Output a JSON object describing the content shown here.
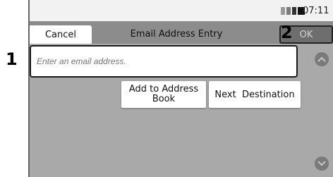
{
  "status_bar": {
    "time": "07:11",
    "signal_icon": "signal-bars-icon"
  },
  "header": {
    "cancel_label": "Cancel",
    "title": "Email Address Entry",
    "ok_label": "OK"
  },
  "email_input": {
    "value": "",
    "placeholder": "Enter an email address."
  },
  "actions": {
    "add_to_address_book_line1": "Add to Address",
    "add_to_address_book_line2": "Book",
    "next_destination_label": "Next  Destination"
  },
  "callouts": [
    "1",
    "2"
  ],
  "scroll": {
    "up_icon": "chevron-up-icon",
    "down_icon": "chevron-down-icon"
  },
  "colors": {
    "background": "#a9a9a9",
    "title_bar": "#8c8c8c",
    "ok_button": "#6e6e6e",
    "button_bg": "#ffffff"
  }
}
